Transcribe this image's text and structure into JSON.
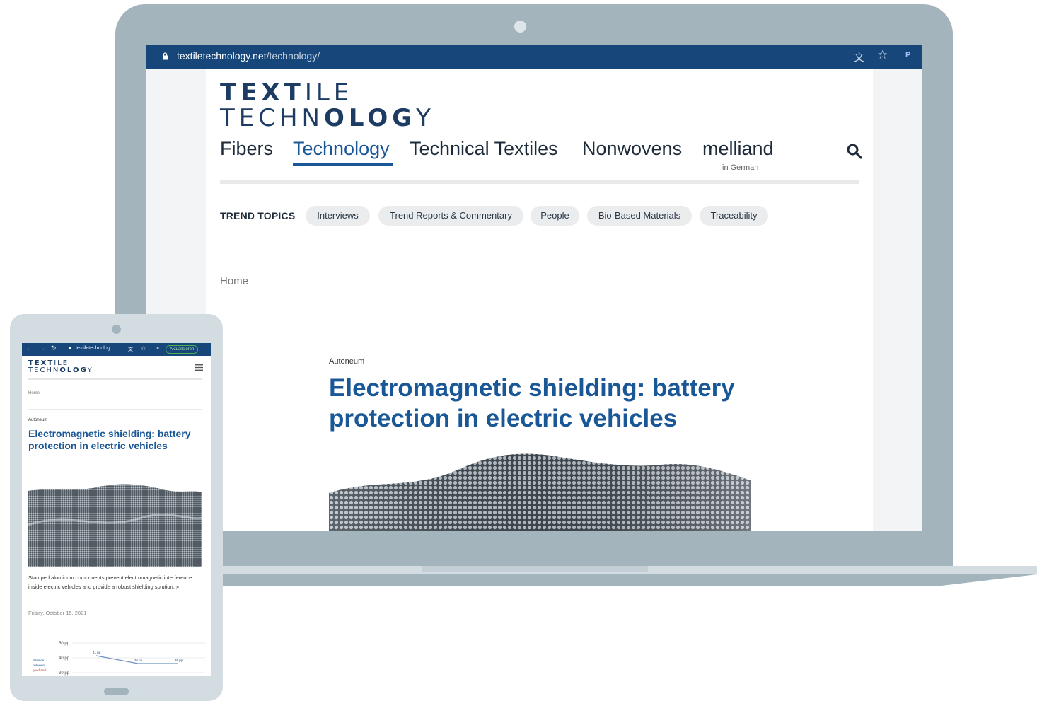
{
  "browser": {
    "url_domain": "textiletechnology.net",
    "url_path": "/technology/",
    "profile_initial": "P"
  },
  "site": {
    "logo_line1": [
      "TEXT",
      "ILE"
    ],
    "logo_line2": [
      "TECHN",
      "OLOG",
      "Y"
    ],
    "nav": [
      {
        "label": "Fibers",
        "active": false
      },
      {
        "label": "Technology",
        "active": true
      },
      {
        "label": "Technical Textiles",
        "active": false
      },
      {
        "label": "Nonwovens",
        "active": false
      },
      {
        "label": "melliand",
        "active": false
      }
    ],
    "melliand_sub": "in German",
    "trend_label": "TREND TOPICS",
    "trend_topics": [
      "Interviews",
      "Trend Reports & Commentary",
      "People",
      "Bio-Based Materials",
      "Traceability"
    ],
    "breadcrumb": "Home"
  },
  "article": {
    "kicker": "Autoneum",
    "headline": "Electromagnetic shielding: battery protection in electric vehicles",
    "mobile_headline": "Electromagnetic shielding: battery protection in electric vehicles",
    "excerpt": "Stamped aluminum components prevent electromagnetic interference inside electric vehicles and provide a robust shielding solution. »",
    "date": "Friday, October 15, 2021"
  },
  "mobile_browser": {
    "url": "textiletechnolog...",
    "update_label": "Aktualisieren"
  },
  "mobile_chart": {
    "y_ticks": [
      "50 pp",
      "40 pp",
      "30 pp"
    ],
    "point_labels": [
      "41 pp",
      "36 pp",
      "36 pp"
    ],
    "series_label_lines": [
      "Balance",
      "between",
      "good and"
    ],
    "accent_color": "#1a5796"
  },
  "colors": {
    "brand_blue": "#1a5796",
    "browser_bar": "#17477a",
    "device_grey": "#a4b4bd"
  }
}
